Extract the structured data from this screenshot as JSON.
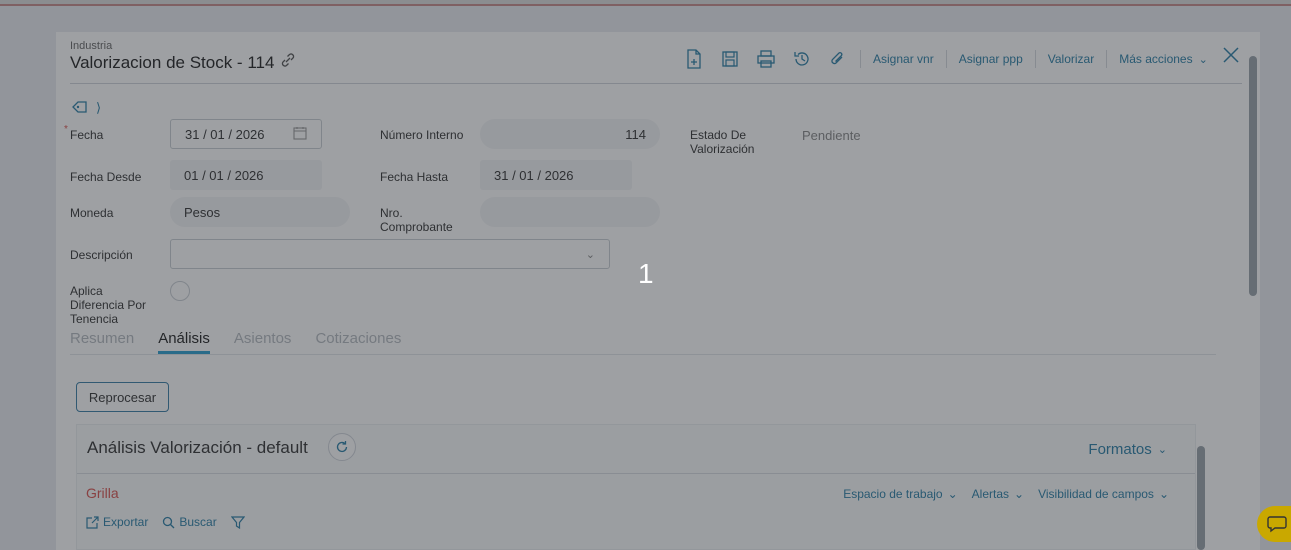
{
  "header": {
    "subtitle": "Industria",
    "title": "Valorizacion de Stock - 114"
  },
  "toolbar": {
    "icons": [
      "new-document-icon",
      "save-icon",
      "print-icon",
      "history-icon",
      "attach-icon"
    ],
    "links": [
      "Asignar vnr",
      "Asignar ppp",
      "Valorizar",
      "Más acciones"
    ]
  },
  "form": {
    "fecha_label": "Fecha",
    "fecha_required": "*",
    "fecha_value": "31 / 01 / 2026",
    "numero_interno_label": "Número Interno",
    "numero_interno_value": "114",
    "estado_label": "Estado De Valorización",
    "estado_value": "Pendiente",
    "fecha_desde_label": "Fecha Desde",
    "fecha_desde_value": "01 / 01 / 2026",
    "fecha_hasta_label": "Fecha Hasta",
    "fecha_hasta_value": "31 / 01 / 2026",
    "moneda_label": "Moneda",
    "moneda_value": "Pesos",
    "nro_comprobante_label": "Nro. Comprobante",
    "nro_comprobante_value": "",
    "descripcion_label": "Descripción",
    "descripcion_value": "",
    "aplica_label": "Aplica Diferencia Por Tenencia"
  },
  "tabs": [
    {
      "label": "Resumen",
      "active": false
    },
    {
      "label": "Análisis",
      "active": true
    },
    {
      "label": "Asientos",
      "active": false
    },
    {
      "label": "Cotizaciones",
      "active": false
    }
  ],
  "analysis": {
    "reprocess_label": "Reprocesar",
    "title": "Análisis Valorización - default",
    "formats_label": "Formatos",
    "grid_label": "Grilla",
    "options": [
      "Espacio de trabajo",
      "Alertas",
      "Visibilidad de campos"
    ],
    "export_label": "Exportar",
    "search_label": "Buscar"
  },
  "overlay": {
    "step_number": "1"
  },
  "colors": {
    "accent": "#2a7fa6",
    "active_tab": "#2a9fd0",
    "required": "#d9534f",
    "chat": "#c9a800"
  }
}
